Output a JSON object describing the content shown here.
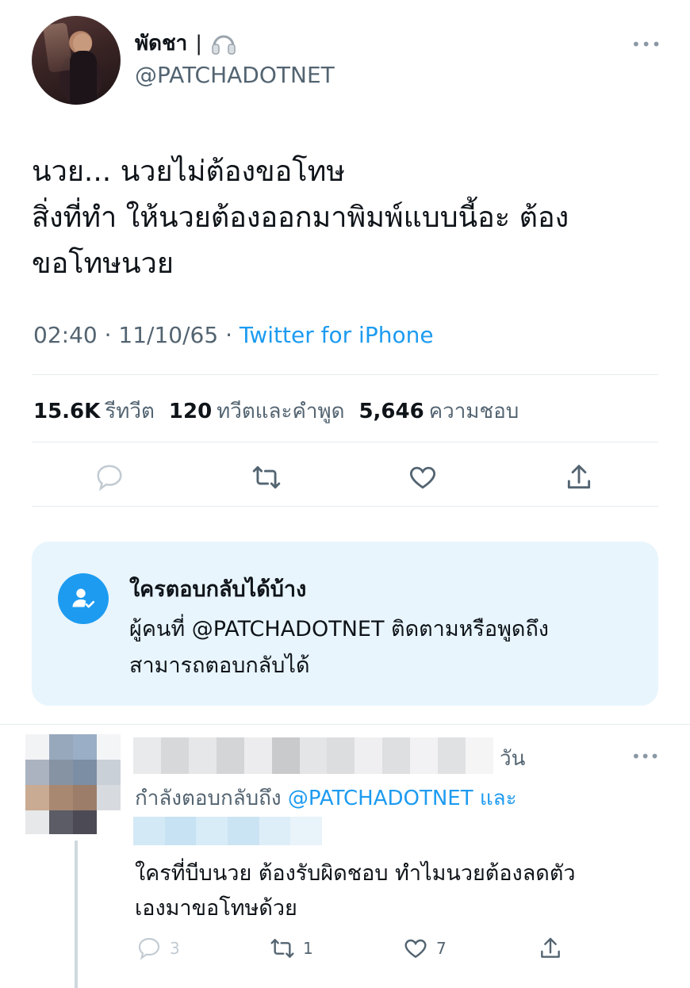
{
  "tweet": {
    "display_name": "พัดชา",
    "name_separator": "|",
    "name_emoji": "headphones-icon",
    "handle": "@PATCHADOTNET",
    "more": "•••",
    "text_lines": [
      "นวย... นวยไม่ต้องขอโทษ",
      "สิ่งที่ทำ ให้นวยต้องออกมาพิมพ์แบบนี้อะ ต้อง",
      "ขอโทษนวย"
    ],
    "time": "02:40",
    "date": "11/10/65",
    "source": "Twitter for iPhone",
    "stats": {
      "retweets": "15.6K",
      "retweets_label": "รีทวีต",
      "quotes": "120",
      "quotes_label": "ทวีตและคำพูด",
      "likes": "5,646",
      "likes_label": "ความชอบ"
    },
    "actions": [
      "reply-icon",
      "retweet-icon",
      "like-icon",
      "share-icon"
    ]
  },
  "reply_restriction": {
    "title": "ใครตอบกลับได้บ้าง",
    "body_lines": [
      "ผู้คนที่ @PATCHADOTNET ติดตามหรือพูดถึง",
      "สามารถตอบกลับได้"
    ]
  },
  "reply": {
    "time": "วัน",
    "more": "•••",
    "replying_to_prefix": "กำลังตอบกลับถึง",
    "replying_to_mention": "@PATCHADOTNET",
    "replying_to_suffix": "และ",
    "text_lines": [
      "ใครที่บีบนวย ต้องรับผิดชอบ ทำไมนวยต้องลดตัว",
      "เองมาขอโทษด้วย"
    ],
    "reply_count": "3",
    "retweet_count": "1",
    "like_count": "7"
  },
  "colors": {
    "accent": "#1d9bf0",
    "secondary_text": "#536471",
    "card_bg": "#e8f5fd"
  }
}
